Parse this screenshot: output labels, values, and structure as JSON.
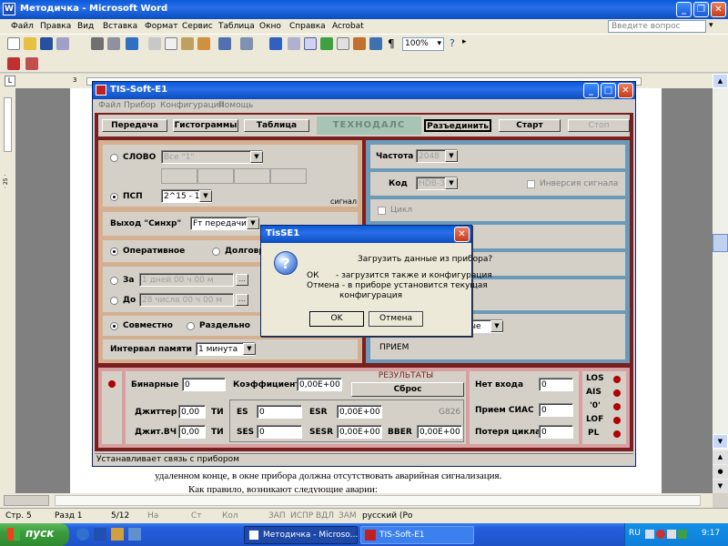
{
  "word": {
    "title": "Методичка - Microsoft Word",
    "menu": [
      "Файл",
      "Правка",
      "Вид",
      "Вставка",
      "Формат",
      "Сервис",
      "Таблица",
      "Окно",
      "Справка",
      "Acrobat"
    ],
    "help_placeholder": "Введите вопрос",
    "zoom": "100%",
    "ruler_mark": "3",
    "vruler_text": "· 25 ·",
    "doc_lines": [
      "удаленном конце, в окне прибора должна отсутствовать аварийная сигнализация.",
      "Как правило, возникают следующие аварии:"
    ],
    "status": {
      "page": "Стр. 5",
      "section": "Разд 1",
      "pages": "5/12",
      "na": "На",
      "st": "Ст",
      "kol": "Кол",
      "flags": [
        "ЗАП",
        "ИСПР",
        "ВДЛ",
        "ЗАМ"
      ],
      "lang": "русский (Ро"
    }
  },
  "app": {
    "title": "TIS-Soft-E1",
    "menu": [
      "Файл",
      "Прибор",
      "Конфигурация",
      "Помощь"
    ],
    "toolbar": {
      "transmit": "Передача",
      "histograms": "Гистограммы",
      "table": "Таблица",
      "brand": "ТЕХНОДАЛС",
      "disconnect": "Разъединить",
      "start": "Старт",
      "stop": "Стоп"
    },
    "left": {
      "word_label": "СЛОВО",
      "word_value": "Все \"1\"",
      "psp_label": "ПСП",
      "psp_value": "2^15 - 1",
      "signal": "сигнал",
      "sync_label": "Выход \"Синхр\"",
      "sync_value": "Fт передачи",
      "operative": "Оперативное",
      "long": "Долговр",
      "za": "За",
      "za_value": "1 дней  00 ч  00 м",
      "do": "До",
      "do_value": "28 числа  00 ч  00 м",
      "together": "Совместно",
      "separate": "Раздельно",
      "interval_label": "Интервал памяти",
      "interval_value": "1 минута"
    },
    "right": {
      "freq_label": "Частота",
      "freq_value": "2048",
      "code_label": "Код",
      "code_value": "HDB-3",
      "inverse": "Инверсия сигнала",
      "cycle": "Цикл",
      "data_tail": "ные",
      "receive": "ПРИЕМ"
    },
    "results": {
      "title": "РЕЗУЛЬТАТЫ",
      "reset": "Сброс",
      "binary_label": "Бинарные",
      "binary_value": "0",
      "coeff_label": "Коэффициент",
      "coeff_value": "0,00E+00",
      "jitter_label": "Джиттер",
      "jitter_value": "0,00",
      "jitter_unit": "ТИ",
      "jitter_hf_label": "Джит.ВЧ",
      "jitter_hf_value": "0,00",
      "jitter_hf_unit": "ТИ",
      "es_label": "ES",
      "es_value": "0",
      "esr_label": "ESR",
      "esr_value": "0,00E+00",
      "g826": "G826",
      "ses_label": "SES",
      "ses_value": "0",
      "sesr_label": "SESR",
      "sesr_value": "0,00E+00",
      "bber_label": "BBER",
      "bber_value": "0,00E+00",
      "no_input_label": "Нет входа",
      "no_input_value": "0",
      "ais_rx_label": "Прием СИАС",
      "ais_rx_value": "0",
      "loss_label": "Потеря цикла",
      "loss_value": "0",
      "alarms": [
        "LOS",
        "AIS",
        "'0'",
        "LOF",
        "PL"
      ]
    },
    "status_text": "Устанавливает связь с прибором"
  },
  "dialog": {
    "title": "TisSE1",
    "question": "Загрузить данные из прибора?",
    "ok_key": "ОК",
    "ok_desc": "- загрузится также и конфигурация",
    "cancel_desc_1": "Отмена - в приборе установится текущая",
    "cancel_desc_2": "конфигурация",
    "ok_button": "OK",
    "cancel_button": "Отмена"
  },
  "taskbar": {
    "start": "пуск",
    "tasks": [
      "Методичка - Microso...",
      "TIS-Soft-E1"
    ],
    "lang": "RU",
    "clock": "9:17"
  },
  "colors": {
    "xp_blue": "#0a246a",
    "app_bg": "#d4d0c8",
    "maroon": "#7a1f1f",
    "pink": "#d8a0a0",
    "teal": "#6a9ab8",
    "tan": "#d4b090",
    "start_green": "#3c9b3c"
  }
}
